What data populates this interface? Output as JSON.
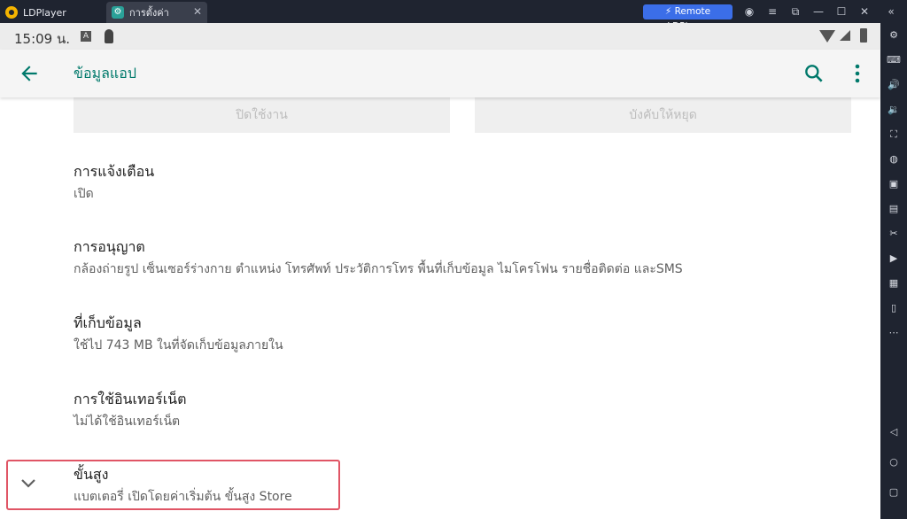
{
  "titlebar": {
    "tabs": [
      {
        "label": "LDPlayer"
      },
      {
        "label": "การตั้งค่า"
      }
    ],
    "remote_label": "Remote LDPlayer"
  },
  "statusbar": {
    "time": "15:09 น.",
    "notif_letter": "A"
  },
  "appbar": {
    "title": "ข้อมูลแอป"
  },
  "buttons": {
    "disable": "ปิดใช้งาน",
    "force_stop": "บังคับให้หยุด"
  },
  "items": [
    {
      "title": "การแจ้งเตือน",
      "subtitle": "เปิด"
    },
    {
      "title": "การอนุญาต",
      "subtitle": "กล้องถ่ายรูป เซ็นเซอร์ร่างกาย ตำแหน่ง โทรศัพท์ ประวัติการโทร พื้นที่เก็บข้อมูล ไมโครโฟน รายชื่อติดต่อ และSMS"
    },
    {
      "title": "ที่เก็บข้อมูล",
      "subtitle": "ใช้ไป 743 MB ในที่จัดเก็บข้อมูลภายใน"
    },
    {
      "title": "การใช้อินเทอร์เน็ต",
      "subtitle": "ไม่ได้ใช้อินเทอร์เน็ต"
    },
    {
      "title": "ขั้นสูง",
      "subtitle": "แบตเตอรี่ เปิดโดยค่าเริ่มต้น ขั้นสูง Store"
    }
  ],
  "colors": {
    "accent": "#00796b",
    "highlight": "#e05565",
    "titlebar": "#1f2430",
    "remote_button": "#3b6ee8"
  },
  "icons": [
    "back-arrow-icon",
    "search-icon",
    "more-vert-icon",
    "chevron-down-icon",
    "gear-icon",
    "wifi-icon",
    "signal-icon",
    "battery-icon"
  ]
}
